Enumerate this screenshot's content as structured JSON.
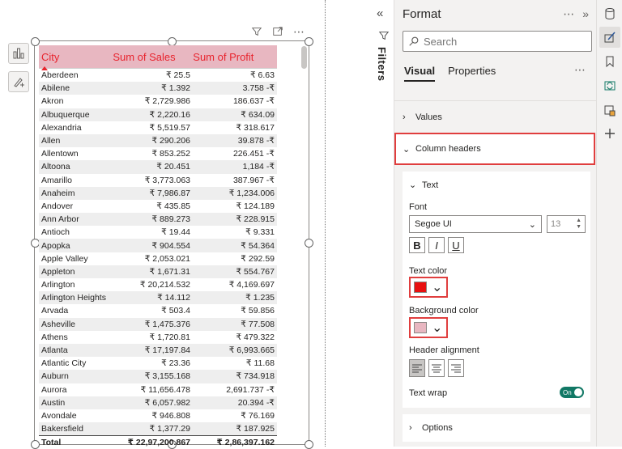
{
  "table": {
    "headers": {
      "city": "City",
      "sales": "Sum of Sales",
      "profit": "Sum of Profit"
    },
    "rows": [
      {
        "city": "Aberdeen",
        "sales": "₹ 25.5",
        "profit": "₹ 6.63"
      },
      {
        "city": "Abilene",
        "sales": "₹ 1.392",
        "profit": "3.758 -₹"
      },
      {
        "city": "Akron",
        "sales": "₹ 2,729.986",
        "profit": "186.637 -₹"
      },
      {
        "city": "Albuquerque",
        "sales": "₹ 2,220.16",
        "profit": "₹ 634.09"
      },
      {
        "city": "Alexandria",
        "sales": "₹ 5,519.57",
        "profit": "₹ 318.617"
      },
      {
        "city": "Allen",
        "sales": "₹ 290.206",
        "profit": "39.878 -₹"
      },
      {
        "city": "Allentown",
        "sales": "₹ 853.252",
        "profit": "226.451 -₹"
      },
      {
        "city": "Altoona",
        "sales": "₹ 20.451",
        "profit": "1,184 -₹"
      },
      {
        "city": "Amarillo",
        "sales": "₹ 3,773.063",
        "profit": "387.967 -₹"
      },
      {
        "city": "Anaheim",
        "sales": "₹ 7,986.87",
        "profit": "₹ 1,234.006"
      },
      {
        "city": "Andover",
        "sales": "₹ 435.85",
        "profit": "₹ 124.189"
      },
      {
        "city": "Ann Arbor",
        "sales": "₹ 889.273",
        "profit": "₹ 228.915"
      },
      {
        "city": "Antioch",
        "sales": "₹ 19.44",
        "profit": "₹ 9.331"
      },
      {
        "city": "Apopka",
        "sales": "₹ 904.554",
        "profit": "₹ 54.364"
      },
      {
        "city": "Apple Valley",
        "sales": "₹ 2,053.021",
        "profit": "₹ 292.59"
      },
      {
        "city": "Appleton",
        "sales": "₹ 1,671.31",
        "profit": "₹ 554.767"
      },
      {
        "city": "Arlington",
        "sales": "₹ 20,214.532",
        "profit": "₹ 4,169.697"
      },
      {
        "city": "Arlington Heights",
        "sales": "₹ 14.112",
        "profit": "₹ 1.235"
      },
      {
        "city": "Arvada",
        "sales": "₹ 503.4",
        "profit": "₹ 59.856"
      },
      {
        "city": "Asheville",
        "sales": "₹ 1,475.376",
        "profit": "₹ 77.508"
      },
      {
        "city": "Athens",
        "sales": "₹ 1,720.81",
        "profit": "₹ 479.322"
      },
      {
        "city": "Atlanta",
        "sales": "₹ 17,197.84",
        "profit": "₹ 6,993.665"
      },
      {
        "city": "Atlantic City",
        "sales": "₹ 23.36",
        "profit": "₹ 11.68"
      },
      {
        "city": "Auburn",
        "sales": "₹ 3,155.168",
        "profit": "₹ 734.918"
      },
      {
        "city": "Aurora",
        "sales": "₹ 11,656.478",
        "profit": "2,691.737 -₹"
      },
      {
        "city": "Austin",
        "sales": "₹ 6,057.982",
        "profit": "20.394 -₹"
      },
      {
        "city": "Avondale",
        "sales": "₹ 946.808",
        "profit": "₹ 76.169"
      },
      {
        "city": "Bakersfield",
        "sales": "₹ 1,377.29",
        "profit": "₹ 187.925"
      }
    ],
    "total": {
      "label": "Total",
      "sales": "₹ 22,97,200.867",
      "profit": "₹ 2,86,397.162"
    }
  },
  "filters": {
    "label": "Filters"
  },
  "format_pane": {
    "title": "Format",
    "search_placeholder": "Search",
    "tabs": {
      "visual": "Visual",
      "properties": "Properties"
    },
    "sections": {
      "values": "Values",
      "column_headers": "Column headers",
      "text": "Text",
      "options": "Options"
    },
    "font_label": "Font",
    "font_family": "Segoe UI",
    "font_size": "13",
    "style_buttons": {
      "bold": "B",
      "italic": "I",
      "underline": "U"
    },
    "text_color_label": "Text color",
    "text_color": "#e81010",
    "background_color_label": "Background color",
    "background_color": "#e8b7c1",
    "header_alignment_label": "Header alignment",
    "text_wrap_label": "Text wrap",
    "text_wrap_state": "On"
  },
  "colors": {
    "accent_red": "#e03e3e",
    "header_text": "#e8242e",
    "toggle_on": "#117865"
  }
}
